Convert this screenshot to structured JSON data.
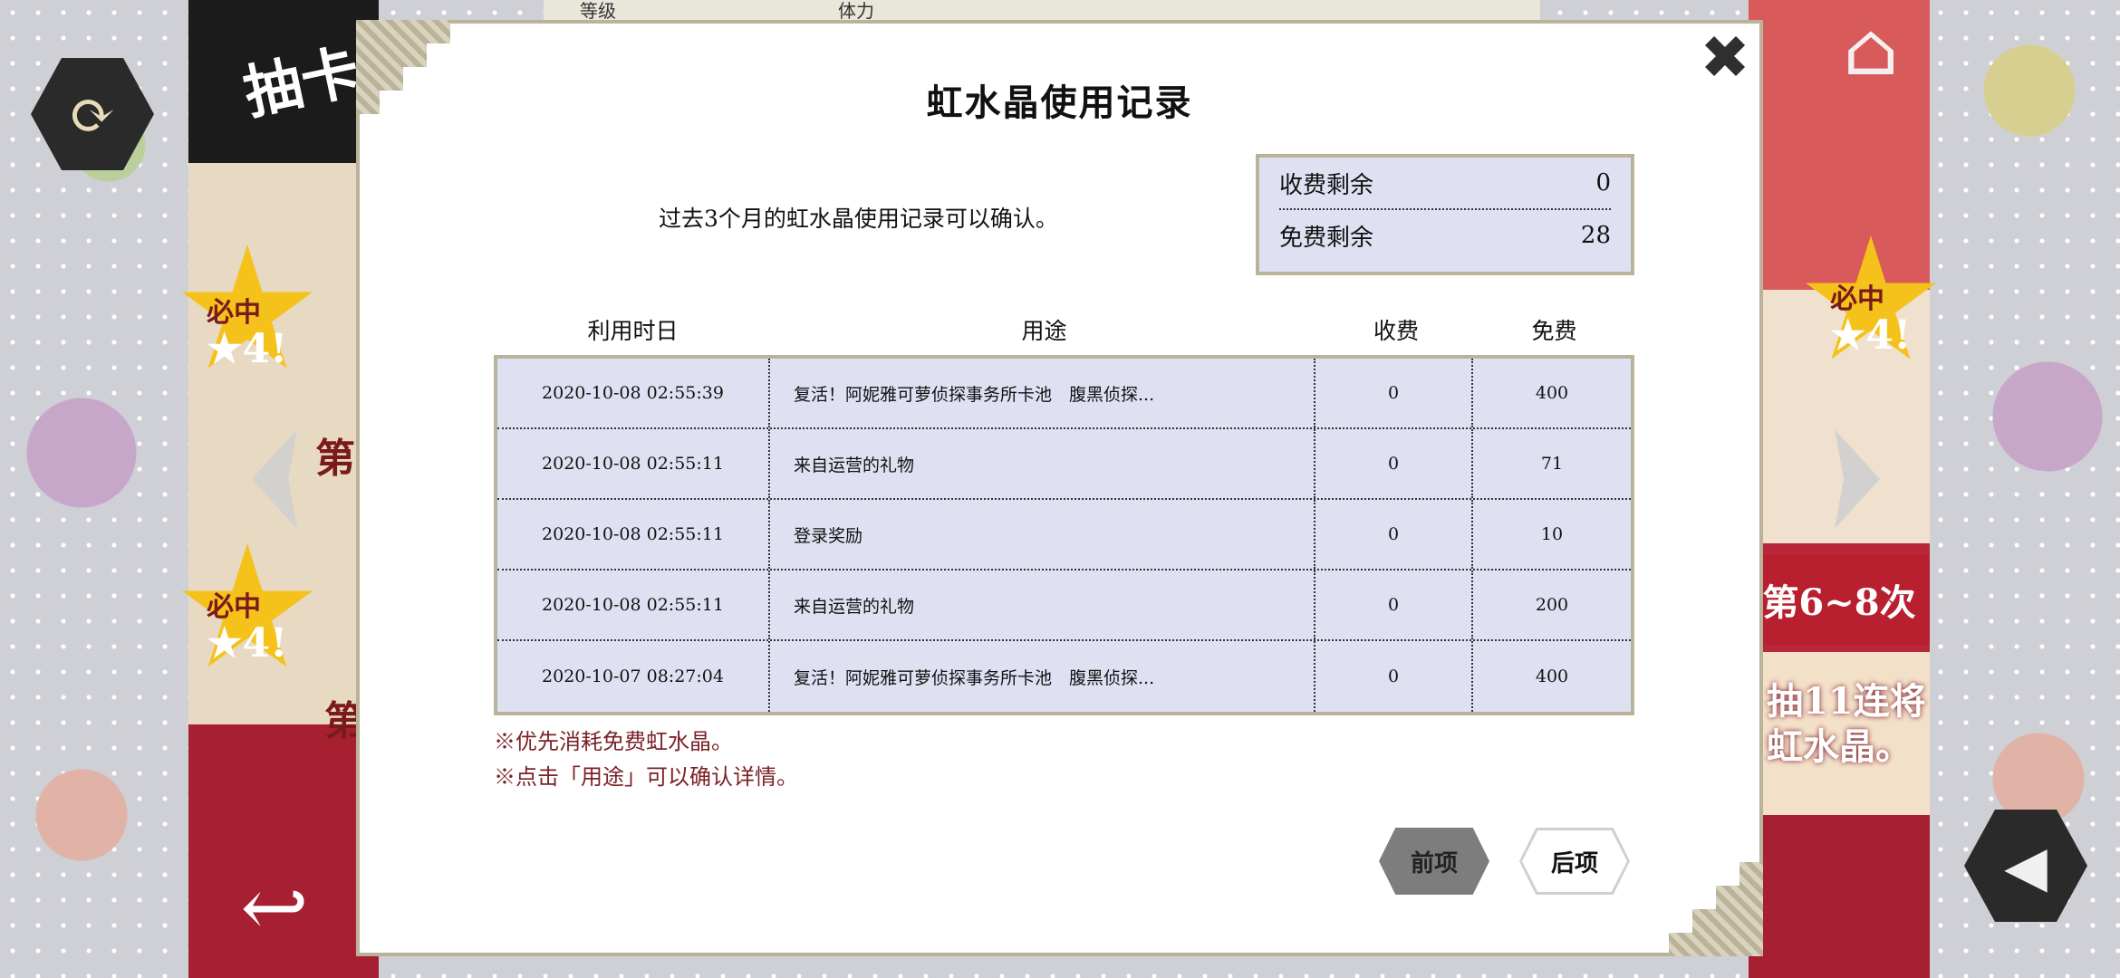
{
  "dialog": {
    "title": "虹水晶使用记录",
    "subtitle": "过去3个月的虹水晶使用记录可以确认。",
    "close_icon": "close-icon"
  },
  "balance": {
    "paid_label": "收费剩余",
    "paid_value": "0",
    "free_label": "免费剩余",
    "free_value": "28"
  },
  "table": {
    "headers": [
      "利用时日",
      "用途",
      "收费",
      "免费"
    ],
    "rows": [
      {
        "date": "2020-10-08 02:55:39",
        "use": "复活！阿妮雅可萝侦探事务所卡池　腹黑侦探...",
        "paid": "0",
        "free": "400"
      },
      {
        "date": "2020-10-08 02:55:11",
        "use": "来自运营的礼物",
        "paid": "0",
        "free": "71"
      },
      {
        "date": "2020-10-08 02:55:11",
        "use": "登录奖励",
        "paid": "0",
        "free": "10"
      },
      {
        "date": "2020-10-08 02:55:11",
        "use": "来自运营的礼物",
        "paid": "0",
        "free": "200"
      },
      {
        "date": "2020-10-07 08:27:04",
        "use": "复活！阿妮雅可萝侦探事务所卡池　腹黑侦探...",
        "paid": "0",
        "free": "400"
      }
    ]
  },
  "notes": [
    "※优先消耗免费虹水晶。",
    "※点击「用途」可以确认详情。"
  ],
  "pager": {
    "prev_label": "前项",
    "next_label": "后项"
  },
  "background": {
    "left_banner_title": "抽卡",
    "left_labels": [
      "必中",
      "★4!",
      "第",
      "必中",
      "★4!",
      "第"
    ],
    "right_labels": [
      "必中",
      "★4!"
    ],
    "right_ribbon": "第6~8次",
    "right_crystal_text": [
      "抽11连将",
      "虹水晶。"
    ],
    "top_stat_labels": [
      "等级",
      "体力"
    ]
  },
  "icons": {
    "refresh": "refresh-icon",
    "sound": "sound-icon",
    "back": "back-icon",
    "home": "home-icon",
    "left_arrow": "chevron-left-icon",
    "right_arrow": "chevron-right-icon"
  }
}
